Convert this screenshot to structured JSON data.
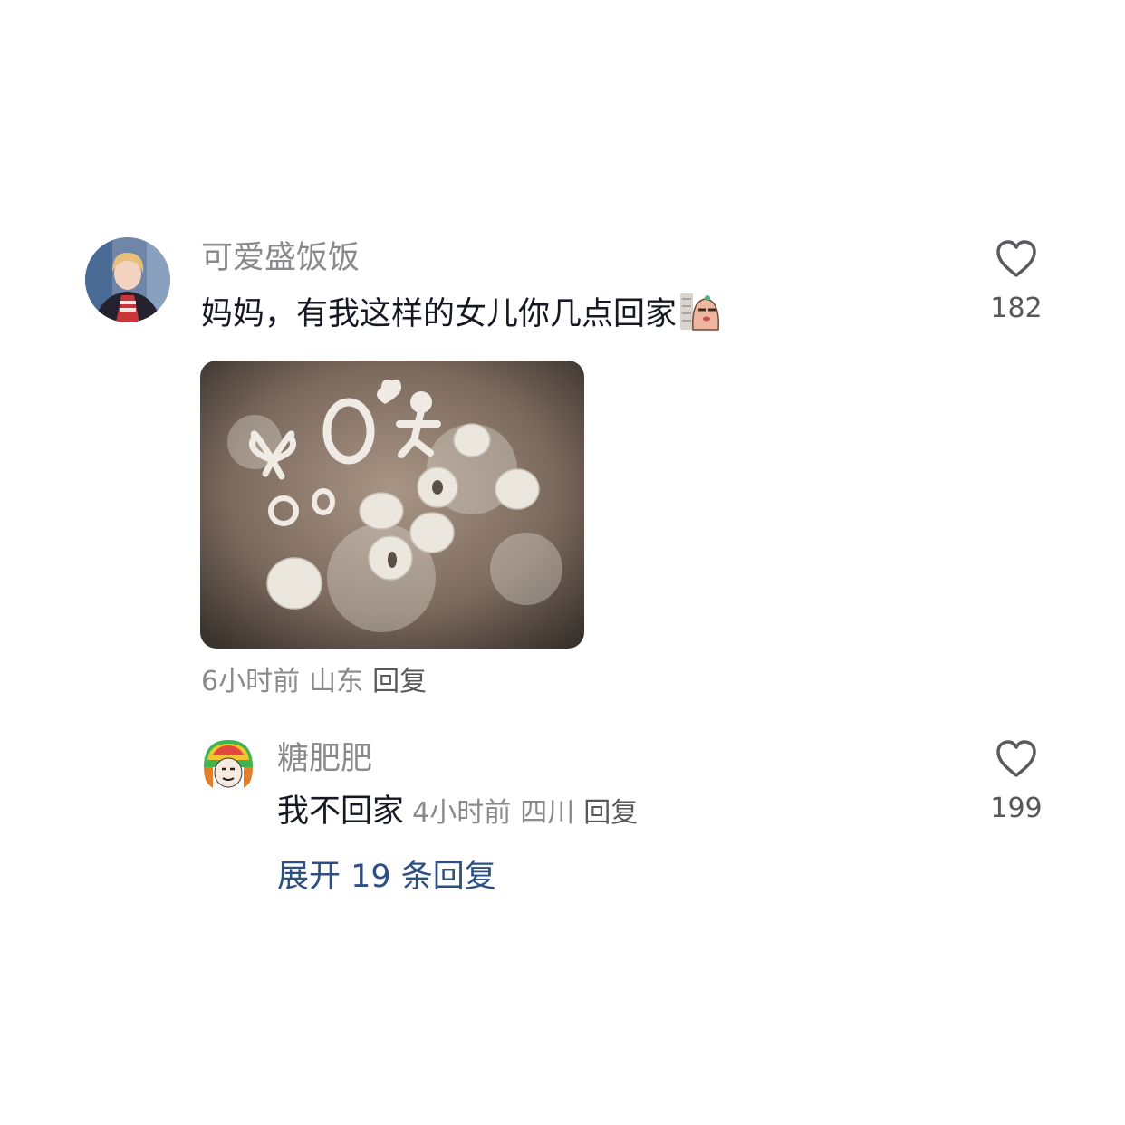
{
  "comment": {
    "username": "可爱盛饭饭",
    "text": "妈妈，有我这样的女儿你几点回家",
    "time": "6小时前",
    "location": "山东",
    "reply_label": "回复",
    "likes": "182",
    "icons": {
      "like": "heart-outline-icon",
      "sticker": "peeking-bean-sticker"
    }
  },
  "reply": {
    "username": "糖肥肥",
    "text": "我不回家",
    "time": "4小时前",
    "location": "四川",
    "reply_label": "回复",
    "likes": "199",
    "icons": {
      "like": "heart-outline-icon"
    }
  },
  "expand_label": "展开 19 条回复",
  "colors": {
    "link": "#2c4f86",
    "secondary": "#8a8a8e",
    "text": "#161823"
  }
}
